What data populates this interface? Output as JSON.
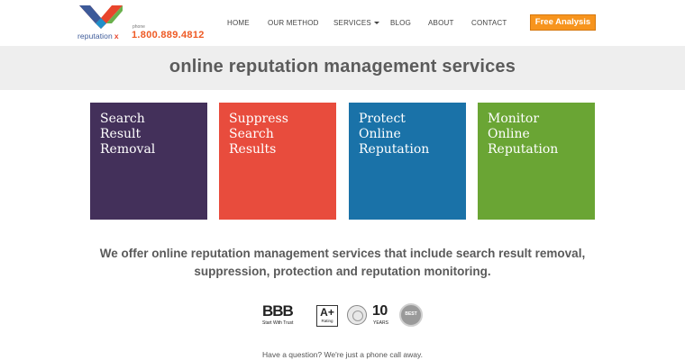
{
  "brand": {
    "name": "reputation",
    "name_x": "x",
    "phone_label": "phone",
    "phone_number": "1.800.889.4812",
    "logo_colors": [
      "#e8452c",
      "#3d5a99",
      "#6ab04c",
      "#1f8fc9"
    ]
  },
  "nav": {
    "items": [
      {
        "label": "HOME"
      },
      {
        "label": "OUR METHOD"
      },
      {
        "label": "SERVICES"
      },
      {
        "label": "BLOG"
      },
      {
        "label": "ABOUT"
      },
      {
        "label": "CONTACT"
      }
    ],
    "cta_label": "Free Analysis"
  },
  "banner": {
    "title": "online reputation management services"
  },
  "tiles": [
    {
      "lines": [
        "Search",
        "Result",
        "Removal"
      ],
      "color": "#43305a"
    },
    {
      "lines": [
        "Suppress",
        "Search",
        "Results"
      ],
      "color": "#e84c3d"
    },
    {
      "lines": [
        "Protect",
        "Online",
        "Reputation"
      ],
      "color": "#1a72a8"
    },
    {
      "lines": [
        "Monitor",
        "Online",
        "Reputation"
      ],
      "color": "#6aa534"
    }
  ],
  "intro": {
    "line1": "We offer online reputation management services that include search result removal,",
    "line2": "suppression, protection and reputation monitoring."
  },
  "badges": {
    "bbb": "BBB",
    "bbb_sub": "Start With Trust",
    "rating_grade": "A+",
    "rating_label": "Rating",
    "years_number": "10",
    "years_label": "YEARS",
    "best_label": "BEST"
  },
  "footer": {
    "question": "Have a question? We're just a phone call away."
  }
}
